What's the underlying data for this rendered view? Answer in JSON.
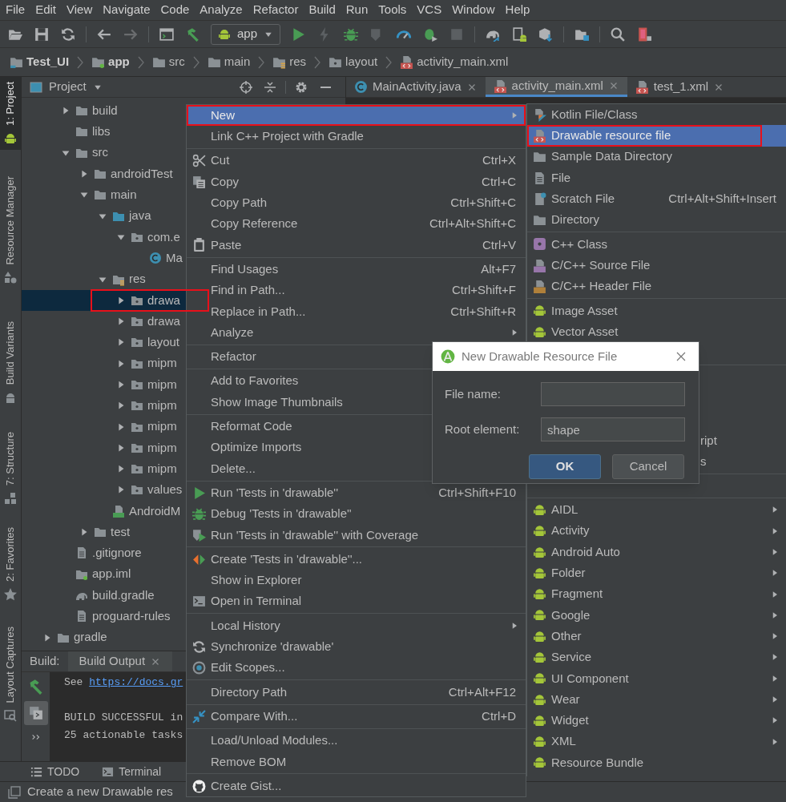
{
  "menu_bar": [
    "File",
    "Edit",
    "View",
    "Navigate",
    "Code",
    "Analyze",
    "Refactor",
    "Build",
    "Run",
    "Tools",
    "VCS",
    "Window",
    "Help"
  ],
  "toolbar": [
    {
      "kind": "open",
      "disabled": false
    },
    {
      "kind": "save",
      "disabled": false
    },
    {
      "kind": "refresh",
      "disabled": false
    },
    {
      "kind": "separator"
    },
    {
      "kind": "back",
      "disabled": false
    },
    {
      "kind": "forward",
      "disabled": true
    },
    {
      "kind": "separator"
    },
    {
      "kind": "window",
      "disabled": false
    },
    {
      "kind": "hammer",
      "disabled": false
    },
    {
      "kind": "run-config",
      "label": "app",
      "disabled": false
    },
    {
      "kind": "play",
      "disabled": false
    },
    {
      "kind": "lightning",
      "disabled": true
    },
    {
      "kind": "bug",
      "disabled": false
    },
    {
      "kind": "coverage",
      "disabled": true
    },
    {
      "kind": "gauge",
      "disabled": false
    },
    {
      "kind": "attach",
      "disabled": false
    },
    {
      "kind": "stop",
      "disabled": true
    },
    {
      "kind": "separator"
    },
    {
      "kind": "elephant",
      "disabled": false
    },
    {
      "kind": "avd",
      "disabled": false
    },
    {
      "kind": "sdk",
      "disabled": false
    },
    {
      "kind": "separator"
    },
    {
      "kind": "structure",
      "disabled": false
    },
    {
      "kind": "separator"
    },
    {
      "kind": "search",
      "disabled": false
    },
    {
      "kind": "device",
      "disabled": false
    }
  ],
  "breadcrumb": [
    {
      "label": "Test_UI",
      "kind": "project",
      "bold": true
    },
    {
      "label": "app",
      "kind": "module",
      "bold": true
    },
    {
      "label": "src",
      "kind": "folder",
      "bold": false
    },
    {
      "label": "main",
      "kind": "folder",
      "bold": false
    },
    {
      "label": "res",
      "kind": "res-folder",
      "bold": false
    },
    {
      "label": "layout",
      "kind": "package",
      "bold": false
    },
    {
      "label": "activity_main.xml",
      "kind": "xml",
      "bold": false
    }
  ],
  "tool_stripe": [
    {
      "label": "1: Project",
      "selected": true
    },
    {
      "label": "Resource Manager",
      "selected": false
    },
    {
      "label": "Build Variants",
      "selected": false
    },
    {
      "label": "7: Structure",
      "selected": false
    },
    {
      "label": "2: Favorites",
      "selected": false
    },
    {
      "label": "Layout Captures",
      "selected": false
    }
  ],
  "project_panel": {
    "title": "Project",
    "tree": {
      "inner_items": [
        {
          "label": "build",
          "kind": "folder",
          "expanded": false,
          "selected": false,
          "highlighted": false
        },
        {
          "label": "libs",
          "kind": "folder",
          "selected": false,
          "highlighted": false
        },
        {
          "label": "src",
          "kind": "folder",
          "expanded": true,
          "selected": false,
          "highlighted": false,
          "children": [
            {
              "label": "androidTest",
              "kind": "folder",
              "expanded": false,
              "selected": false,
              "highlighted": false
            },
            {
              "label": "main",
              "kind": "folder",
              "expanded": true,
              "selected": false,
              "highlighted": false,
              "children": [
                {
                  "label": "java",
                  "kind": "source-folder",
                  "expanded": true,
                  "selected": false,
                  "highlighted": false,
                  "children": [
                    {
                      "label": "com.e",
                      "kind": "package",
                      "expanded": true,
                      "selected": false,
                      "highlighted": false,
                      "children": [
                        {
                          "label": "Ma",
                          "kind": "class",
                          "selected": false,
                          "highlighted": false
                        }
                      ]
                    }
                  ]
                },
                {
                  "label": "res",
                  "kind": "res-folder",
                  "expanded": true,
                  "selected": false,
                  "highlighted": false,
                  "children": [
                    {
                      "label": "drawa",
                      "kind": "package",
                      "expanded": false,
                      "selected": true,
                      "highlighted": true
                    },
                    {
                      "label": "drawa",
                      "kind": "package",
                      "expanded": false,
                      "selected": false,
                      "highlighted": false
                    },
                    {
                      "label": "layout",
                      "kind": "package",
                      "expanded": false,
                      "selected": false,
                      "highlighted": false
                    },
                    {
                      "label": "mipm",
                      "kind": "package",
                      "expanded": false,
                      "selected": false,
                      "highlighted": false
                    },
                    {
                      "label": "mipm",
                      "kind": "package",
                      "expanded": false,
                      "selected": false,
                      "highlighted": false
                    },
                    {
                      "label": "mipm",
                      "kind": "package",
                      "expanded": false,
                      "selected": false,
                      "highlighted": false
                    },
                    {
                      "label": "mipm",
                      "kind": "package",
                      "expanded": false,
                      "selected": false,
                      "highlighted": false
                    },
                    {
                      "label": "mipm",
                      "kind": "package",
                      "expanded": false,
                      "selected": false,
                      "highlighted": false
                    },
                    {
                      "label": "mipm",
                      "kind": "package",
                      "expanded": false,
                      "selected": false,
                      "highlighted": false
                    },
                    {
                      "label": "values",
                      "kind": "package",
                      "expanded": false,
                      "selected": false,
                      "highlighted": false
                    }
                  ]
                },
                {
                  "label": "AndroidM",
                  "kind": "manifest",
                  "selected": false,
                  "highlighted": false
                }
              ]
            },
            {
              "label": "test",
              "kind": "folder",
              "expanded": false,
              "selected": false,
              "highlighted": false
            }
          ]
        },
        {
          "label": ".gitignore",
          "kind": "file",
          "selected": false,
          "highlighted": false
        },
        {
          "label": "app.iml",
          "kind": "module-file",
          "selected": false,
          "highlighted": false
        },
        {
          "label": "build.gradle",
          "kind": "gradle-file",
          "selected": false,
          "highlighted": false
        },
        {
          "label": "proguard-rules",
          "kind": "file",
          "selected": false,
          "highlighted": false
        }
      ],
      "outer_items": [
        {
          "label": "gradle",
          "kind": "folder",
          "expanded": false,
          "selected": false,
          "highlighted": false
        }
      ]
    }
  },
  "editor_tabs": [
    {
      "label": "MainActivity.java",
      "kind": "class",
      "selected": false
    },
    {
      "label": "activity_main.xml",
      "kind": "xml",
      "selected": true
    },
    {
      "label": "test_1.xml",
      "kind": "xml",
      "selected": false
    }
  ],
  "build_panel": {
    "title": "Build:",
    "tab": "Build Output",
    "console": [
      {
        "text": "See ",
        "link": "https://docs.gr"
      },
      {
        "text": "BUILD SUCCESSFUL in"
      },
      {
        "text": "25 actionable tasks"
      }
    ]
  },
  "bottom_tabs": [
    {
      "label": "TODO",
      "kind": "list"
    },
    {
      "label": "Terminal",
      "kind": "terminal"
    }
  ],
  "status_bar": "Create a new Drawable res",
  "context_menu": {
    "items": [
      {
        "kind": "plain",
        "label": "New",
        "submenu": true,
        "selected": true,
        "highlighted": true
      },
      {
        "kind": "plain",
        "label": "Link C++ Project with Gradle",
        "submenu": false,
        "selected": false,
        "highlighted": false
      },
      {
        "kind": "separator"
      },
      {
        "kind": "cut",
        "label": "Cut",
        "shortcut": "Ctrl+X",
        "submenu": false,
        "selected": false,
        "highlighted": false
      },
      {
        "kind": "copy",
        "label": "Copy",
        "shortcut": "Ctrl+C",
        "submenu": false,
        "selected": false,
        "highlighted": false
      },
      {
        "kind": "plain",
        "label": "Copy Path",
        "shortcut": "Ctrl+Shift+C",
        "submenu": false,
        "selected": false,
        "highlighted": false
      },
      {
        "kind": "plain",
        "label": "Copy Reference",
        "shortcut": "Ctrl+Alt+Shift+C",
        "submenu": false,
        "selected": false,
        "highlighted": false
      },
      {
        "kind": "paste",
        "label": "Paste",
        "shortcut": "Ctrl+V",
        "submenu": false,
        "selected": false,
        "highlighted": false
      },
      {
        "kind": "separator"
      },
      {
        "kind": "plain",
        "label": "Find Usages",
        "shortcut": "Alt+F7",
        "submenu": false,
        "selected": false,
        "highlighted": false
      },
      {
        "kind": "plain",
        "label": "Find in Path...",
        "shortcut": "Ctrl+Shift+F",
        "submenu": false,
        "selected": false,
        "highlighted": false
      },
      {
        "kind": "plain",
        "label": "Replace in Path...",
        "shortcut": "Ctrl+Shift+R",
        "submenu": false,
        "selected": false,
        "highlighted": false
      },
      {
        "kind": "plain",
        "label": "Analyze",
        "submenu": true,
        "selected": false,
        "highlighted": false
      },
      {
        "kind": "separator"
      },
      {
        "kind": "plain",
        "label": "Refactor",
        "selected": false,
        "highlighted": false
      },
      {
        "kind": "separator"
      },
      {
        "kind": "plain",
        "label": "Add to Favorites",
        "selected": false,
        "highlighted": false
      },
      {
        "kind": "plain",
        "label": "Show Image Thumbnails",
        "selected": false,
        "highlighted": false
      },
      {
        "kind": "separator"
      },
      {
        "kind": "plain",
        "label": "Reformat Code",
        "selected": false,
        "highlighted": false
      },
      {
        "kind": "plain",
        "label": "Optimize Imports",
        "selected": false,
        "highlighted": false
      },
      {
        "kind": "plain",
        "label": "Delete...",
        "selected": false,
        "highlighted": false
      },
      {
        "kind": "separator"
      },
      {
        "kind": "run",
        "label": "Run 'Tests in 'drawable''",
        "shortcut": "Ctrl+Shift+F10",
        "submenu": false,
        "selected": false,
        "highlighted": false
      },
      {
        "kind": "debug",
        "label": "Debug 'Tests in 'drawable''",
        "submenu": false,
        "selected": false,
        "highlighted": false
      },
      {
        "kind": "coverage",
        "label": "Run 'Tests in 'drawable'' with Coverage",
        "submenu": false,
        "selected": false,
        "highlighted": false
      },
      {
        "kind": "separator"
      },
      {
        "kind": "create-test",
        "label": "Create 'Tests in 'drawable''...",
        "submenu": false,
        "selected": false,
        "highlighted": false
      },
      {
        "kind": "plain",
        "label": "Show in Explorer",
        "submenu": false,
        "selected": false,
        "highlighted": false
      },
      {
        "kind": "terminal",
        "label": "Open in Terminal",
        "submenu": false,
        "selected": false,
        "highlighted": false
      },
      {
        "kind": "separator"
      },
      {
        "kind": "plain",
        "label": "Local History",
        "submenu": true,
        "selected": false,
        "highlighted": false
      },
      {
        "kind": "sync",
        "label": "Synchronize 'drawable'",
        "submenu": false,
        "selected": false,
        "highlighted": false
      },
      {
        "kind": "scope",
        "label": "Edit Scopes...",
        "submenu": false,
        "selected": false,
        "highlighted": false
      },
      {
        "kind": "separator"
      },
      {
        "kind": "plain",
        "label": "Directory Path",
        "shortcut": "Ctrl+Alt+F12",
        "submenu": false,
        "selected": false,
        "highlighted": false
      },
      {
        "kind": "separator"
      },
      {
        "kind": "compare",
        "label": "Compare With...",
        "shortcut": "Ctrl+D",
        "submenu": false,
        "selected": false,
        "highlighted": false
      },
      {
        "kind": "separator"
      },
      {
        "kind": "plain",
        "label": "Load/Unload Modules...",
        "submenu": false,
        "selected": false,
        "highlighted": false
      },
      {
        "kind": "plain",
        "label": "Remove BOM",
        "submenu": false,
        "selected": false,
        "highlighted": false
      },
      {
        "kind": "separator"
      },
      {
        "kind": "gist",
        "label": "Create Gist...",
        "submenu": false,
        "selected": false,
        "highlighted": false
      }
    ]
  },
  "new_submenu": {
    "items": [
      {
        "kind": "kotlin",
        "label": "Kotlin File/Class",
        "submenu": false,
        "selected": false,
        "highlighted": false
      },
      {
        "kind": "xml",
        "label": "Drawable resource file",
        "submenu": false,
        "selected": true,
        "highlighted": true
      },
      {
        "kind": "folder",
        "label": "Sample Data Directory",
        "submenu": false,
        "selected": false,
        "highlighted": false
      },
      {
        "kind": "file",
        "label": "File",
        "submenu": false,
        "selected": false,
        "highlighted": false
      },
      {
        "kind": "scratch",
        "label": "Scratch File",
        "shortcut": "Ctrl+Alt+Shift+Insert",
        "submenu": false,
        "selected": false,
        "highlighted": false
      },
      {
        "kind": "folder",
        "label": "Directory",
        "submenu": false,
        "selected": false,
        "highlighted": false
      },
      {
        "kind": "separator"
      },
      {
        "kind": "cpp-class",
        "label": "C++ Class",
        "submenu": false,
        "selected": false,
        "highlighted": false
      },
      {
        "kind": "cpp-source",
        "label": "C/C++ Source File",
        "submenu": false,
        "selected": false,
        "highlighted": false
      },
      {
        "kind": "cpp-header",
        "label": "C/C++ Header File",
        "submenu": false,
        "selected": false,
        "highlighted": false
      },
      {
        "kind": "separator"
      },
      {
        "kind": "android",
        "label": "Image Asset",
        "submenu": false,
        "selected": false,
        "highlighted": false
      },
      {
        "kind": "android",
        "label": "Vector Asset",
        "submenu": false,
        "selected": false,
        "highlighted": false
      }
    ],
    "partial_items": [
      "ript",
      "s"
    ],
    "android_items": [
      {
        "kind": "android",
        "label": "AIDL",
        "submenu": true,
        "selected": false,
        "highlighted": false
      },
      {
        "kind": "android",
        "label": "Activity",
        "submenu": true,
        "selected": false,
        "highlighted": false
      },
      {
        "kind": "android",
        "label": "Android Auto",
        "submenu": true,
        "selected": false,
        "highlighted": false
      },
      {
        "kind": "android",
        "label": "Folder",
        "submenu": true,
        "selected": false,
        "highlighted": false
      },
      {
        "kind": "android",
        "label": "Fragment",
        "submenu": true,
        "selected": false,
        "highlighted": false
      },
      {
        "kind": "android",
        "label": "Google",
        "submenu": true,
        "selected": false,
        "highlighted": false
      },
      {
        "kind": "android",
        "label": "Other",
        "submenu": true,
        "selected": false,
        "highlighted": false
      },
      {
        "kind": "android",
        "label": "Service",
        "submenu": true,
        "selected": false,
        "highlighted": false
      },
      {
        "kind": "android",
        "label": "UI Component",
        "submenu": true,
        "selected": false,
        "highlighted": false
      },
      {
        "kind": "android",
        "label": "Wear",
        "submenu": true,
        "selected": false,
        "highlighted": false
      },
      {
        "kind": "android",
        "label": "Widget",
        "submenu": true,
        "selected": false,
        "highlighted": false
      },
      {
        "kind": "android",
        "label": "XML",
        "submenu": true,
        "selected": false,
        "highlighted": false
      },
      {
        "kind": "android",
        "label": "Resource Bundle",
        "submenu": false,
        "selected": false,
        "highlighted": false
      }
    ]
  },
  "dialog": {
    "title": "New Drawable Resource File",
    "fields": [
      {
        "label": "File name:"
      },
      {
        "label": "Root element:",
        "value": "shape"
      }
    ],
    "buttons": [
      {
        "label": "OK",
        "primary": true
      },
      {
        "label": "Cancel",
        "primary": false
      }
    ]
  }
}
